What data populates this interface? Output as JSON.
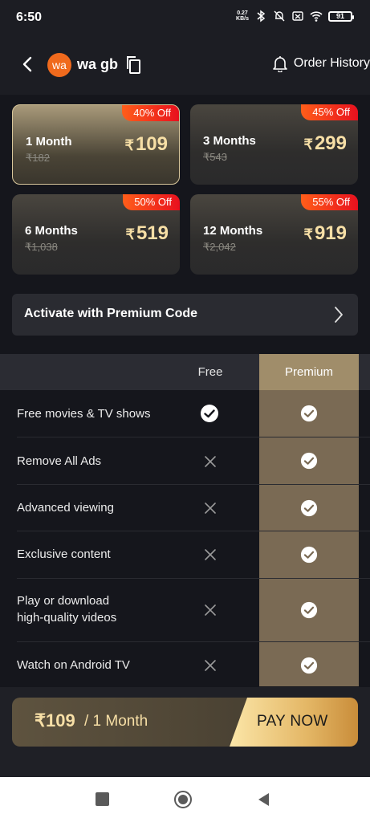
{
  "status_bar": {
    "time": "6:50",
    "net_speed": "0.27",
    "net_unit": "KB/s",
    "battery": "91"
  },
  "header": {
    "avatar_text": "wa",
    "username": "wa gb",
    "order_history": "Order History"
  },
  "plans": [
    {
      "duration": "1 Month",
      "original": "₹182",
      "currency": "₹",
      "price": "109",
      "discount": "40% Off",
      "selected": true
    },
    {
      "duration": "3 Months",
      "original": "₹543",
      "currency": "₹",
      "price": "299",
      "discount": "45% Off",
      "selected": false
    },
    {
      "duration": "6 Months",
      "original": "₹1,038",
      "currency": "₹",
      "price": "519",
      "discount": "50% Off",
      "selected": false
    },
    {
      "duration": "12 Months",
      "original": "₹2,042",
      "currency": "₹",
      "price": "919",
      "discount": "55% Off",
      "selected": false
    }
  ],
  "premium_code": {
    "label": "Activate with Premium Code"
  },
  "comparison": {
    "col_free": "Free",
    "col_premium": "Premium",
    "rows": [
      {
        "feature": "Free movies & TV shows",
        "free": true,
        "premium": true
      },
      {
        "feature": "Remove All Ads",
        "free": false,
        "premium": true
      },
      {
        "feature": "Advanced viewing",
        "free": false,
        "premium": true
      },
      {
        "feature": "Exclusive content",
        "free": false,
        "premium": true
      },
      {
        "feature": "Play or download",
        "feature_line2": "high-quality videos",
        "free": false,
        "premium": true
      },
      {
        "feature": "Watch on Android TV",
        "free": false,
        "premium": true
      }
    ]
  },
  "pay_bar": {
    "amount": "₹109",
    "period": "/ 1 Month",
    "button": "PAY NOW"
  },
  "colors": {
    "accent_gold": "#f7dfa6",
    "discount_red": "#e8101e",
    "premium_column": "#7a6a54",
    "avatar_orange": "#f06a1d"
  }
}
